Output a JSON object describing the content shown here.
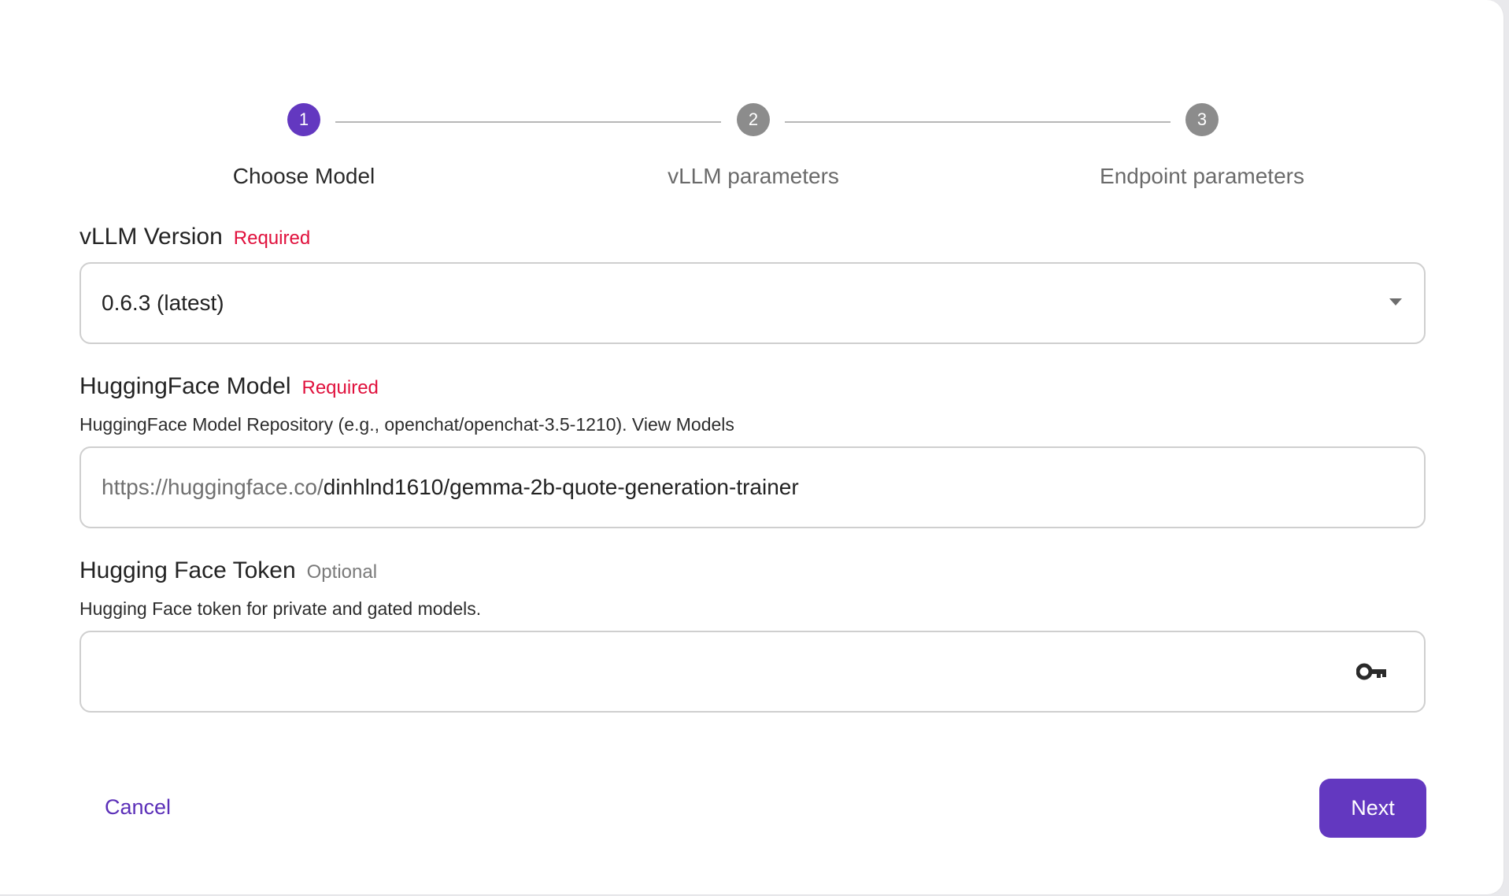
{
  "stepper": {
    "steps": [
      {
        "number": "1",
        "label": "Choose Model",
        "state": "active"
      },
      {
        "number": "2",
        "label": "vLLM parameters",
        "state": "pending"
      },
      {
        "number": "3",
        "label": "Endpoint parameters",
        "state": "pending"
      }
    ]
  },
  "vllm_version": {
    "title": "vLLM Version",
    "badge": "Required",
    "selected": "0.6.3 (latest)"
  },
  "hf_model": {
    "title": "HuggingFace Model",
    "badge": "Required",
    "help": "HuggingFace Model Repository (e.g., openchat/openchat-3.5-1210). View Models",
    "prefix": "https://huggingface.co/",
    "value": "dinhlnd1610/gemma-2b-quote-generation-trainer"
  },
  "hf_token": {
    "title": "Hugging Face Token",
    "badge": "Optional",
    "help": "Hugging Face token for private and gated models.",
    "value": "",
    "icon": "key-icon"
  },
  "actions": {
    "cancel_label": "Cancel",
    "next_label": "Next"
  },
  "colors": {
    "accent": "#6338c0",
    "required": "#e0103c",
    "inactive_step": "#8c8c8c"
  }
}
